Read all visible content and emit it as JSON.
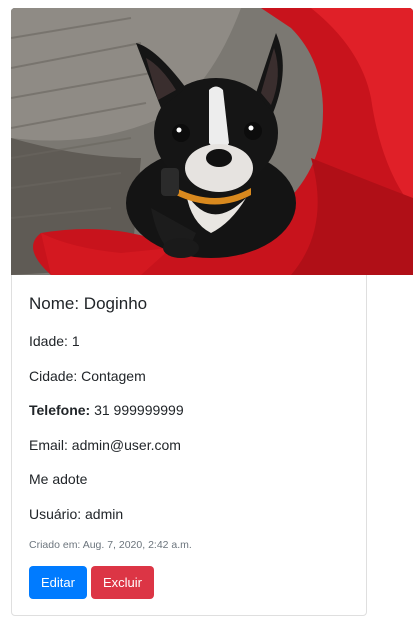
{
  "pet": {
    "name_line": "Nome: Doginho",
    "age_line": "Idade: 1",
    "city_line": "Cidade: Contagem",
    "phone_label": "Telefone:",
    "phone_value": " 31 999999999",
    "email_line": "Email: admin@user.com",
    "description": "Me adote",
    "user_line": "Usuário: admin",
    "created_line": "Criado em: Aug. 7, 2020, 2:42 a.m."
  },
  "actions": {
    "edit_label": "Editar",
    "delete_label": "Excluir"
  },
  "colors": {
    "edit_button": "#007bff",
    "delete_button": "#dc3545",
    "muted_text": "#6c757d"
  }
}
